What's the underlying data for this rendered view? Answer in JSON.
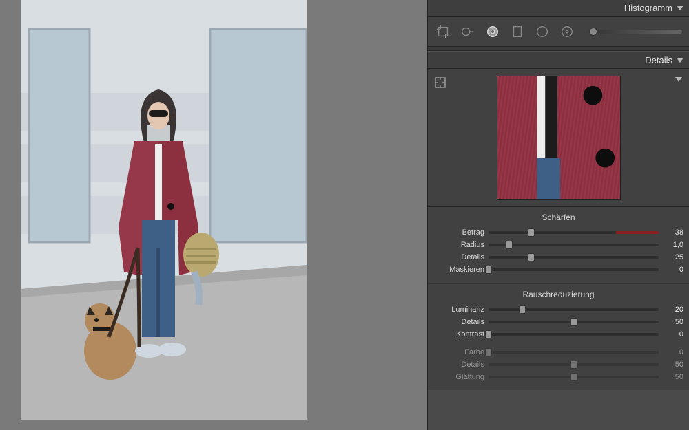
{
  "histogram": {
    "title": "Histogramm"
  },
  "details_section": {
    "title": "Details"
  },
  "sharpen": {
    "title": "Schärfen",
    "amount": {
      "label": "Betrag",
      "value": "38",
      "pos": 25
    },
    "radius": {
      "label": "Radius",
      "value": "1,0",
      "pos": 12
    },
    "detail": {
      "label": "Details",
      "value": "25",
      "pos": 25
    },
    "masking": {
      "label": "Maskieren",
      "value": "0",
      "pos": 0
    }
  },
  "noise": {
    "title": "Rauschreduzierung",
    "luminance": {
      "label": "Luminanz",
      "value": "20",
      "pos": 20
    },
    "lum_detail": {
      "label": "Details",
      "value": "50",
      "pos": 50
    },
    "lum_contrast": {
      "label": "Kontrast",
      "value": "0",
      "pos": 0
    },
    "color": {
      "label": "Farbe",
      "value": "0",
      "pos": 0
    },
    "col_detail": {
      "label": "Details",
      "value": "50",
      "pos": 50
    },
    "col_smooth": {
      "label": "Glättung",
      "value": "50",
      "pos": 50
    }
  },
  "chart_data": null
}
